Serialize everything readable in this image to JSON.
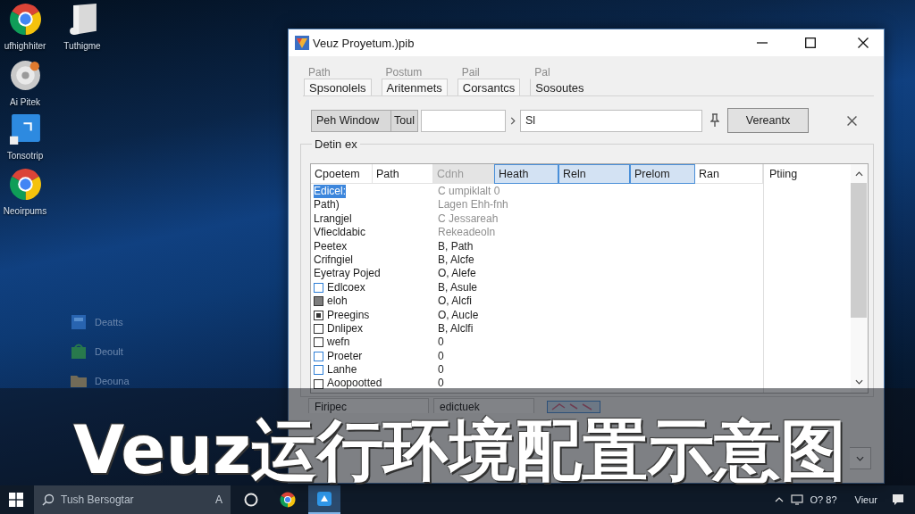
{
  "desktop_icons": [
    {
      "label": "ufhighhiter",
      "kind": "browser"
    },
    {
      "label": "Tuthigme",
      "kind": "file"
    },
    {
      "label": "Ai Pitek",
      "kind": "disc"
    },
    {
      "label": "Tonsotrip",
      "kind": "shortcut"
    },
    {
      "label": "Neoirpums",
      "kind": "browser"
    }
  ],
  "faded_icons": [
    {
      "label": "Deatts",
      "kind": "window"
    },
    {
      "label": "Deoult",
      "kind": "store"
    },
    {
      "label": "Deouna",
      "kind": "folder"
    }
  ],
  "window": {
    "title": "Veuz Proyetum.)pib",
    "tabs": [
      {
        "caption": "Path",
        "label": "Spsonolels",
        "selected": false
      },
      {
        "caption": "Postum",
        "label": "Aritenmets",
        "selected": false
      },
      {
        "caption": "Pail",
        "label": "Corsantcs",
        "selected": false
      },
      {
        "caption": "Pal",
        "label": "Sosoutes",
        "selected": true
      }
    ],
    "toolbar": {
      "buttons": [
        "Peh Window",
        "Toul"
      ],
      "path_value": "Sl",
      "action_button": "Vereantx"
    },
    "group_title": "Detin ex",
    "table": {
      "columns": [
        {
          "label": "Cpoetem",
          "selected": false,
          "disabled": false
        },
        {
          "label": "Path",
          "selected": false,
          "disabled": false
        },
        {
          "label": "Cdnh",
          "selected": false,
          "disabled": true
        },
        {
          "label": "Heath",
          "selected": true,
          "disabled": false
        },
        {
          "label": "Reln",
          "selected": true,
          "disabled": false
        },
        {
          "label": "Prelom",
          "selected": true,
          "disabled": false
        },
        {
          "label": "Ran",
          "selected": false,
          "disabled": false
        }
      ],
      "side_header": "Ptiing",
      "rows": [
        {
          "name": "Edicel:",
          "value": "C umpiklalt 0",
          "selected": true,
          "disabled": true
        },
        {
          "name": "Path)",
          "value": "Lagen Ehh-fnh",
          "selected": false,
          "disabled": true
        },
        {
          "name": "Lrangjel",
          "value": "C Jessareah",
          "selected": false,
          "disabled": true
        },
        {
          "name": "Vfiecldabic",
          "value": "Rekeadeoln",
          "selected": false,
          "disabled": true
        },
        {
          "name": "Peetex",
          "value": "B, Path",
          "selected": false,
          "disabled": false
        },
        {
          "name": "Crifngiel",
          "value": "B, Alcfe",
          "selected": false,
          "disabled": false
        },
        {
          "name": "Eyetray Pojed",
          "value": "O, Alefe",
          "selected": false,
          "disabled": false
        },
        {
          "name": "Edlcoex",
          "value": "B, Asule",
          "selected": false,
          "disabled": false,
          "checkbox": {
            "checked": false,
            "mixed": false,
            "focused": true
          }
        },
        {
          "name": "eloh",
          "value": "O, Alcfi",
          "selected": false,
          "disabled": false,
          "checkbox": {
            "checked": false,
            "mixed": true,
            "focused": false
          }
        },
        {
          "name": "Preegins",
          "value": "O, Aucle",
          "selected": false,
          "disabled": false,
          "checkbox": {
            "checked": true,
            "mixed": false,
            "focused": false
          }
        },
        {
          "name": "Dnlipex",
          "value": "B, Alclfi",
          "selected": false,
          "disabled": false,
          "checkbox": {
            "checked": false,
            "mixed": false,
            "focused": false
          }
        },
        {
          "name": "wefn",
          "value": "0",
          "selected": false,
          "disabled": false,
          "checkbox": {
            "checked": false,
            "mixed": false,
            "focused": false
          }
        },
        {
          "name": "Proeter",
          "value": "0",
          "selected": false,
          "disabled": false,
          "checkbox": {
            "checked": false,
            "mixed": false,
            "focused": true
          }
        },
        {
          "name": "Lanhe",
          "value": "0",
          "selected": false,
          "disabled": false,
          "checkbox": {
            "checked": false,
            "mixed": false,
            "focused": true
          }
        },
        {
          "name": "Aoopootted",
          "value": "0",
          "selected": false,
          "disabled": false,
          "checkbox": {
            "checked": false,
            "mixed": false,
            "focused": false
          }
        }
      ]
    },
    "bottom_fields": [
      "Firipec",
      "edictuek"
    ]
  },
  "caption": "Veuz运行环境配置示意图",
  "taskbar": {
    "search_placeholder": "Tush Bersogtar",
    "search_key": "A",
    "apps": [
      {
        "kind": "ring",
        "selected": false
      },
      {
        "kind": "browser",
        "selected": false
      },
      {
        "kind": "app",
        "selected": true
      }
    ],
    "tray_text": "O? 8?",
    "clock": "Vieur"
  }
}
